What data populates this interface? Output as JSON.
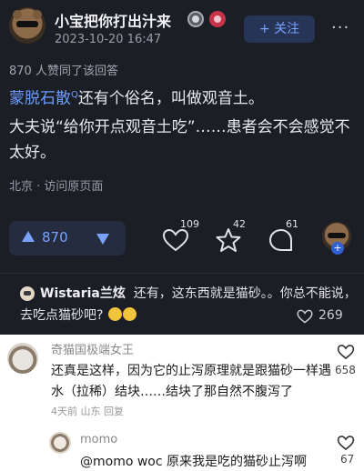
{
  "header": {
    "username": "小宝把你打出汁来",
    "date": "2023-10-20 16:47",
    "follow_label": "+ 关注",
    "more_glyph": "···"
  },
  "answer": {
    "likes_line": "870 人赞同了该回答",
    "link_text": "蒙脱石散",
    "link_sup": "Q",
    "line1_rest": "还有个俗名，叫做观音土。",
    "paragraph2": "大夫说“给你开点观音土吃”……患者会不会感觉不太好。",
    "location": "北京 · 访问原页面"
  },
  "actions": {
    "vote_count": "870",
    "like_count": "109",
    "favorite_count": "42",
    "comment_count": "61"
  },
  "hot_comment": {
    "name": "Wistaria兰炫",
    "text": "还有，这东西就是猫砂。。你总不能说，去吃点猫砂吧?",
    "likes": "269"
  },
  "comments": [
    {
      "name": "奇猫国极端女王",
      "text": "还真是这样，因为它的止泻原理就是跟猫砂一样遇水（拉稀）结块……结块了那自然不腹泻了",
      "meta": "4天前 山东 回复",
      "likes": "658"
    },
    {
      "name": "momo",
      "text": "@momo woc 原来我是吃的猫砂止泻啊",
      "likes": "67"
    }
  ],
  "colors": {
    "dark_bg": "#1c1e26",
    "accent_blue": "#7aa2ff",
    "link_blue": "#6d9cff"
  }
}
